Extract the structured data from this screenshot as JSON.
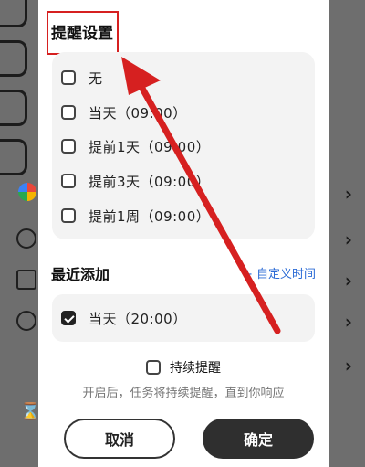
{
  "dialog": {
    "title": "提醒设置",
    "options": [
      {
        "label": "无",
        "checked": false
      },
      {
        "label": "当天（09:00）",
        "checked": false
      },
      {
        "label": "提前1天（09:00）",
        "checked": false
      },
      {
        "label": "提前3天（09:00）",
        "checked": false
      },
      {
        "label": "提前1周（09:00）",
        "checked": false
      }
    ],
    "recent": {
      "title": "最近添加",
      "custom_time": "+ 自定义时间",
      "items": [
        {
          "label": "当天（20:00）",
          "checked": true
        }
      ]
    },
    "persist": {
      "label": "持续提醒",
      "hint": "开启后，任务将持续提醒，直到你响应"
    },
    "buttons": {
      "cancel": "取消",
      "confirm": "确定"
    }
  },
  "colors": {
    "accent_link": "#2b6bd6",
    "annotation": "#d62020",
    "confirm_bg": "#2f2f2f"
  }
}
